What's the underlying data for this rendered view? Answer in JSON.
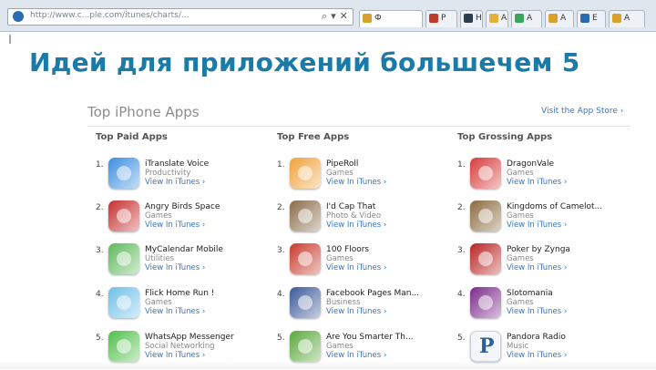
{
  "browser": {
    "address": "http://www.c...ple.com/itunes/charts/...",
    "tabs": [
      {
        "label": "Ф",
        "color": "#d8a12b"
      },
      {
        "label": "Р",
        "color": "#c0392b"
      },
      {
        "label": "Н",
        "color": "#2c3e50"
      },
      {
        "label": "А",
        "color": "#e3b23c"
      },
      {
        "label": "А",
        "color": "#3aa65a"
      },
      {
        "label": "А",
        "color": "#d8a12b"
      },
      {
        "label": "Е",
        "color": "#2b6cb0"
      },
      {
        "label": "А",
        "color": "#d8a12b"
      }
    ]
  },
  "headline": "Идей для приложений большечем 5",
  "panel": {
    "title": "Top iPhone Apps",
    "store_link": "Visit the App Store ›"
  },
  "columns": [
    {
      "heading": "Top Paid Apps",
      "apps": [
        {
          "rank": "1.",
          "name": "iTranslate Voice",
          "category": "Productivity",
          "link": "View In iTunes ›",
          "icon": "microphone-icon",
          "color": "#3b8ee0"
        },
        {
          "rank": "2.",
          "name": "Angry Birds Space",
          "category": "Games",
          "link": "View In iTunes ›",
          "icon": "angry-bird-icon",
          "color": "#c62f2f"
        },
        {
          "rank": "3.",
          "name": "MyCalendar Mobile",
          "category": "Utilities",
          "link": "View In iTunes ›",
          "icon": "calendar-icon",
          "color": "#5fb95c"
        },
        {
          "rank": "4.",
          "name": "Flick Home Run !",
          "category": "Games",
          "link": "View In iTunes ›",
          "icon": "baseball-icon",
          "color": "#6fbfe8"
        },
        {
          "rank": "5.",
          "name": "WhatsApp Messenger",
          "category": "Social Networking",
          "link": "View In iTunes ›",
          "icon": "chat-bubble-icon",
          "color": "#4fc04a"
        }
      ]
    },
    {
      "heading": "Top Free Apps",
      "apps": [
        {
          "rank": "1.",
          "name": "PipeRoll",
          "category": "Games",
          "link": "View In iTunes ›",
          "icon": "pipe-icon",
          "color": "#f0a23a"
        },
        {
          "rank": "2.",
          "name": "I'd Cap That",
          "category": "Photo & Video",
          "link": "View In iTunes ›",
          "icon": "camera-icon",
          "color": "#8a6d4a"
        },
        {
          "rank": "3.",
          "name": "100 Floors",
          "category": "Games",
          "link": "View In iTunes ›",
          "icon": "door-icon",
          "color": "#c93a2e"
        },
        {
          "rank": "4.",
          "name": "Facebook Pages Man...",
          "category": "Business",
          "link": "View In iTunes ›",
          "icon": "flag-icon",
          "color": "#3b5998"
        },
        {
          "rank": "5.",
          "name": "Are You Smarter Th...",
          "category": "Games",
          "link": "View In iTunes ›",
          "icon": "quiz-icon",
          "color": "#5aa83a"
        }
      ]
    },
    {
      "heading": "Top Grossing Apps",
      "apps": [
        {
          "rank": "1.",
          "name": "DragonVale",
          "category": "Games",
          "link": "View In iTunes ›",
          "icon": "dragon-icon",
          "color": "#d83a3a"
        },
        {
          "rank": "2.",
          "name": "Kingdoms of Camelot...",
          "category": "Games",
          "link": "View In iTunes ›",
          "icon": "knight-icon",
          "color": "#8a6a3e"
        },
        {
          "rank": "3.",
          "name": "Poker by Zynga",
          "category": "Games",
          "link": "View In iTunes ›",
          "icon": "cards-icon",
          "color": "#b82424"
        },
        {
          "rank": "4.",
          "name": "Slotomania",
          "category": "Games",
          "link": "View In iTunes ›",
          "icon": "slot-machine-icon",
          "color": "#7a2a8a"
        },
        {
          "rank": "5.",
          "name": "Pandora Radio",
          "category": "Music",
          "link": "View In iTunes ›",
          "icon": "pandora-icon",
          "color": "#2b5f9a",
          "glyph": "P"
        }
      ]
    }
  ]
}
